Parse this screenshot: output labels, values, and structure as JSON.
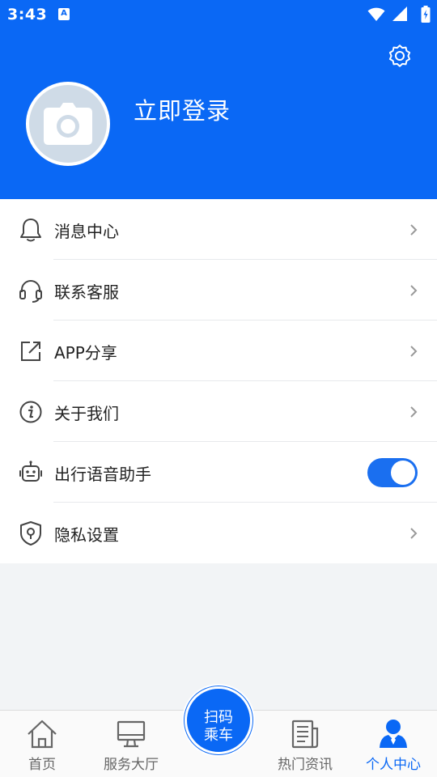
{
  "status_bar": {
    "time": "3:43",
    "notification_badge": "A",
    "icons": [
      "wifi-icon",
      "signal-icon",
      "battery-icon"
    ]
  },
  "header": {
    "background_color": "#0a68f5",
    "login_text": "立即登录",
    "settings_icon": "gear-icon",
    "avatar_icon": "camera-icon"
  },
  "menu": {
    "items": [
      {
        "label": "消息中心",
        "icon": "bell-icon",
        "control": "chevron"
      },
      {
        "label": "联系客服",
        "icon": "headset-icon",
        "control": "chevron"
      },
      {
        "label": "APP分享",
        "icon": "share-icon",
        "control": "chevron"
      },
      {
        "label": "关于我们",
        "icon": "info-icon",
        "control": "chevron"
      },
      {
        "label": "出行语音助手",
        "icon": "robot-icon",
        "control": "toggle",
        "enabled": true
      },
      {
        "label": "隐私设置",
        "icon": "shield-icon",
        "control": "chevron"
      }
    ]
  },
  "bottom_nav": {
    "items": [
      {
        "label": "首页",
        "icon": "home-icon",
        "active": false
      },
      {
        "label": "服务大厅",
        "icon": "monitor-icon",
        "active": false
      },
      {
        "label": "热门资讯",
        "icon": "news-icon",
        "active": false
      },
      {
        "label": "个人中心",
        "icon": "user-icon",
        "active": true
      }
    ],
    "scan_button": {
      "line1": "扫码",
      "line2": "乘车"
    },
    "active_color": "#0a68f5",
    "inactive_color": "#666666"
  }
}
